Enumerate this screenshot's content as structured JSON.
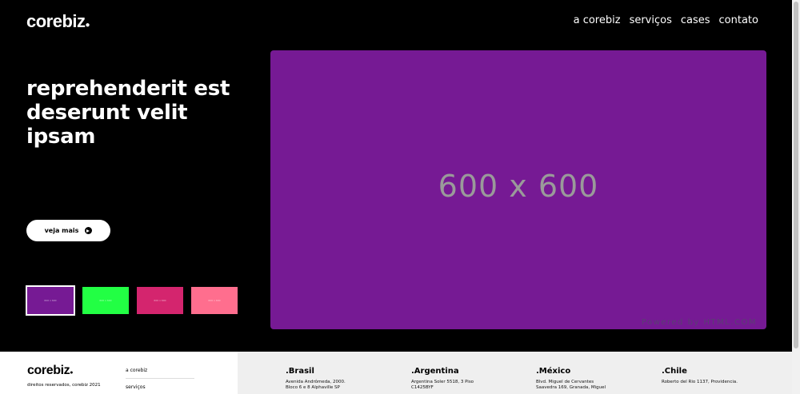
{
  "header": {
    "logo": "corebiz",
    "nav": [
      "a corebiz",
      "serviços",
      "cases",
      "contato"
    ]
  },
  "hero": {
    "headline": "reprehenderit est deserunt velit ipsam",
    "cta_label": "veja mais",
    "thumbnails": [
      {
        "color": "#761a94",
        "active": true
      },
      {
        "color": "#22ff44",
        "active": false
      },
      {
        "color": "#d4256e",
        "active": false
      },
      {
        "color": "#ff6e8e",
        "active": false
      }
    ],
    "banner": {
      "color": "#761a94",
      "dimensions": "600 x 600",
      "credit": "Powered by HTML.COM"
    }
  },
  "footer": {
    "logo": "corebiz",
    "rights": "direitos reservados, corebiz 2021",
    "nav": [
      "a corebiz",
      "serviços"
    ],
    "offices": [
      {
        "country": ".Brasil",
        "address": [
          "Avenida Andrômeda, 2000.",
          "Bloco 6 e 8 Alphaville SP"
        ]
      },
      {
        "country": ".Argentina",
        "address": [
          "Argentina Soler 5518, 3 Piso",
          "C1425BYF"
        ]
      },
      {
        "country": ".México",
        "address": [
          "Blvd. Miguel de Cervantes",
          "Saavedra 169, Granada, Miguel"
        ]
      },
      {
        "country": ".Chile",
        "address": [
          "Roberto del Rio 1137, Providencia."
        ]
      }
    ]
  }
}
